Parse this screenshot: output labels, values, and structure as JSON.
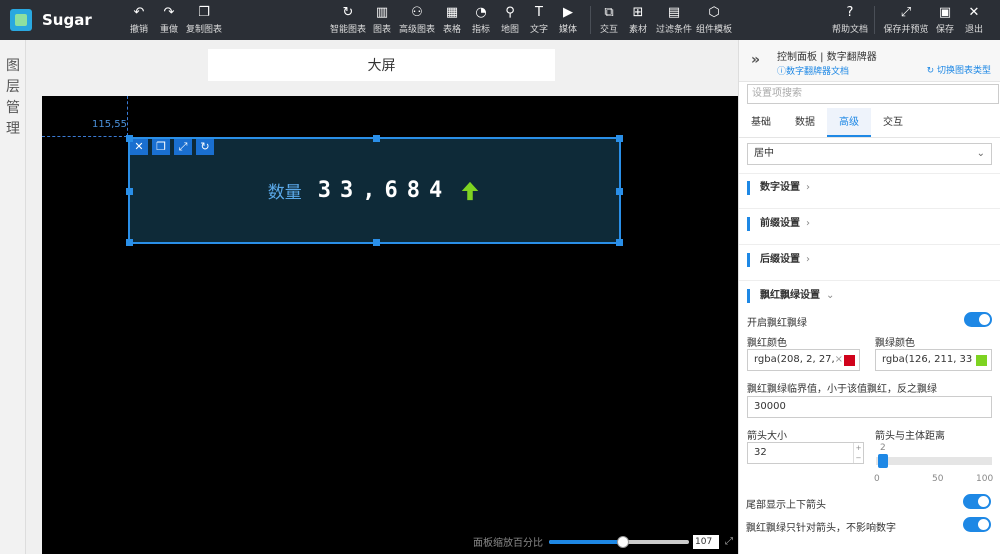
{
  "app": {
    "name": "Sugar"
  },
  "toolbar": {
    "undo": "撤销",
    "redo": "重做",
    "copy_chart": "复制图表",
    "smart_chart": "智能图表",
    "chart": "图表",
    "advanced_chart": "高级图表",
    "table": "表格",
    "indicator": "指标",
    "map": "地图",
    "text": "文字",
    "media": "媒体",
    "interaction": "交互",
    "material": "素材",
    "filter": "过滤条件",
    "template": "组件模板",
    "help": "帮助文档",
    "save_preview": "保存并预览",
    "save": "保存",
    "exit": "退出"
  },
  "left_rail": {
    "label": "图层管理"
  },
  "canvas": {
    "title": "大屏",
    "coord": "115,55",
    "widget": {
      "prefix": "数量",
      "value": "33,684"
    },
    "zoom_label": "面板缩放百分比",
    "zoom_value": "107",
    "zoom_fraction": 0.53
  },
  "panel": {
    "title": "控制面板 | 数字翻牌器",
    "doc_link": "数字翻牌器文档",
    "switch_type": "切换图表类型",
    "search_placeholder": "设置项搜索",
    "tabs": [
      "基础",
      "数据",
      "高级",
      "交互"
    ],
    "align_value": "居中",
    "sections": {
      "number": "数字设置",
      "prefix": "前缀设置",
      "suffix": "后缀设置",
      "red_green": "飘红飘绿设置"
    },
    "enable_red_green": "开启飘红飘绿",
    "red_color_label": "飘红颜色",
    "red_color_value": "rgba(208, 2, 27,",
    "red_color_hex": "#d0021b",
    "green_color_label": "飘绿颜色",
    "green_color_value": "rgba(126, 211, 33",
    "green_color_hex": "#7ed321",
    "threshold_label": "飘红飘绿临界值，小于该值飘红，反之飘绿",
    "threshold_value": "30000",
    "arrow_size_label": "箭头大小",
    "arrow_size_value": "32",
    "arrow_distance_label": "箭头与主体距离",
    "arrow_distance_value": "2",
    "slider_ticks": [
      "0",
      "50",
      "100"
    ],
    "tail_arrow_label": "尾部显示上下箭头",
    "arrow_only_label": "飘红飘绿只针对箭头，不影响数字"
  }
}
